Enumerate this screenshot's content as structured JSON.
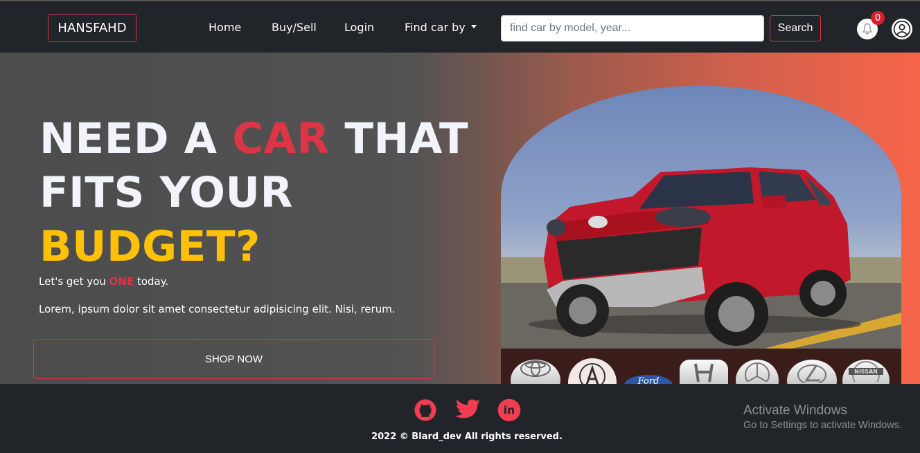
{
  "navbar": {
    "brand": "HANSFAHD",
    "links": [
      "Home",
      "Buy/Sell",
      "Login",
      "Find car by"
    ],
    "search_placeholder": "find car by model, year...",
    "search_value": "",
    "search_button": "Search",
    "notification_count": "0"
  },
  "hero": {
    "headline_part1": "NEED A ",
    "headline_highlight": "CAR",
    "headline_part2": " THAT",
    "headline_line2": "FITS YOUR",
    "headline_line3": "BUDGET?",
    "tagline_before": "Let's get you ",
    "tagline_highlight": "ONE",
    "tagline_after": " today.",
    "description": "Lorem, ipsum dolor sit amet consectetur adipisicing elit. Nisi, rerum.",
    "cta": "SHOP NOW",
    "brand_logos": [
      "toyota-logo",
      "acura-logo",
      "ford-logo",
      "honda-logo",
      "mercedes-logo",
      "lexus-logo",
      "nissan-logo"
    ]
  },
  "footer": {
    "social": [
      "github-icon",
      "twitter-icon",
      "linkedin-icon"
    ],
    "copyright": "2022 © Blard_dev All rights reserved."
  },
  "os_overlay": {
    "title": "Activate Windows",
    "subtitle": "Go to Settings to activate Windows."
  },
  "colors": {
    "accent_red": "#dc3545",
    "accent_yellow": "#ffc107",
    "nav_bg": "#212529",
    "social_red": "#f03d4f"
  }
}
